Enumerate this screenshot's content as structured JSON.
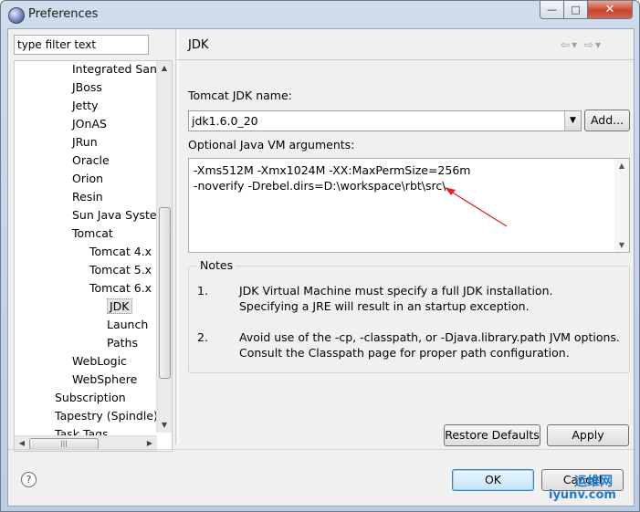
{
  "window": {
    "title": "Preferences",
    "minimize": "—",
    "maximize": "□",
    "close": "✕"
  },
  "filter": {
    "value": "type filter text"
  },
  "tree": [
    {
      "label": "Integrated Sand",
      "indent": 1
    },
    {
      "label": "JBoss",
      "indent": 1
    },
    {
      "label": "Jetty",
      "indent": 1
    },
    {
      "label": "JOnAS",
      "indent": 1
    },
    {
      "label": "JRun",
      "indent": 1
    },
    {
      "label": "Oracle",
      "indent": 1
    },
    {
      "label": "Orion",
      "indent": 1
    },
    {
      "label": "Resin",
      "indent": 1
    },
    {
      "label": "Sun Java System",
      "indent": 1
    },
    {
      "label": "Tomcat",
      "indent": 1
    },
    {
      "label": "Tomcat  4.x",
      "indent": 2
    },
    {
      "label": "Tomcat  5.x",
      "indent": 2
    },
    {
      "label": "Tomcat  6.x",
      "indent": 2
    },
    {
      "label": "JDK",
      "indent": 3,
      "selected": true
    },
    {
      "label": "Launch",
      "indent": 3
    },
    {
      "label": "Paths",
      "indent": 3
    },
    {
      "label": "WebLogic",
      "indent": 1
    },
    {
      "label": "WebSphere",
      "indent": 1
    },
    {
      "label": "Subscription",
      "indent": 0
    },
    {
      "label": "Tapestry (Spindle)",
      "indent": 0
    },
    {
      "label": "Task Tags",
      "indent": 0
    }
  ],
  "page": {
    "title": "JDK",
    "jdk_name_label": "Tomcat JDK name:",
    "jdk_name_value": "jdk1.6.0_20",
    "add_button": "Add...",
    "vm_args_label": "Optional Java VM arguments:",
    "vm_args_lines": [
      "-Xms512M -Xmx1024M -XX:MaxPermSize=256m",
      "-noverify -Drebel.dirs=D:\\workspace\\rbt\\src\\"
    ],
    "notes_title": "Notes",
    "notes": [
      {
        "num": "1.",
        "lines": [
          "JDK Virtual Machine must specify a full JDK installation.",
          "Specifying a JRE will result in an startup exception."
        ]
      },
      {
        "num": "2.",
        "lines": [
          "Avoid use of the -cp, -classpath, or -Djava.library.path JVM options.",
          "Consult the Classpath page for proper path configuration."
        ]
      }
    ],
    "restore_defaults": "Restore Defaults",
    "apply": "Apply"
  },
  "footer": {
    "help": "?",
    "ok": "OK",
    "cancel": "Cancel"
  },
  "watermark": {
    "line1": "运维网",
    "line2": "iyunv.com"
  },
  "colors": {
    "annotation_arrow": "#e0262b",
    "selection": "#e3e3e3"
  }
}
